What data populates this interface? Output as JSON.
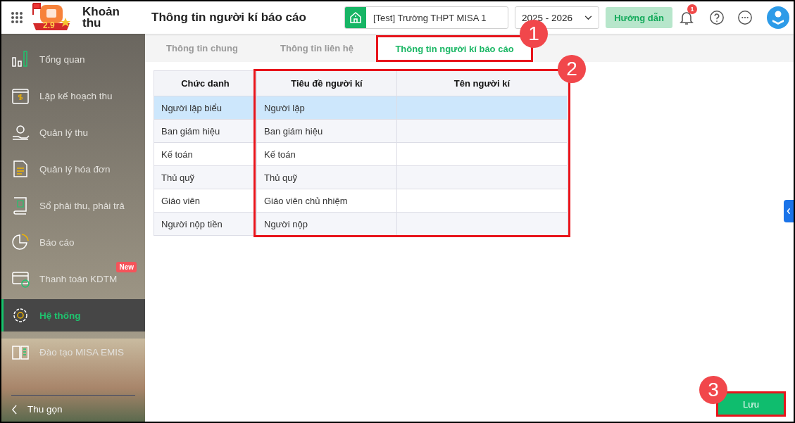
{
  "header": {
    "app_name": "Khoản thu",
    "logo_badge": "2.9",
    "page_title": "Thông tin người kí báo cáo",
    "school": "[Test] Trường THPT MISA 1",
    "year": "2025 - 2026",
    "guide_button": "Hướng dẫn",
    "notification_count": "1"
  },
  "sidebar": {
    "items": [
      {
        "label": "Tổng quan",
        "selected": false
      },
      {
        "label": "Lập kế hoạch thu",
        "selected": false
      },
      {
        "label": "Quản lý thu",
        "selected": false
      },
      {
        "label": "Quản lý hóa đơn",
        "selected": false
      },
      {
        "label": "Sổ phải thu, phải trả",
        "selected": false
      },
      {
        "label": "Báo cáo",
        "selected": false
      },
      {
        "label": "Thanh toán KDTM",
        "selected": false,
        "badge": "New"
      },
      {
        "label": "Hệ thống",
        "selected": true
      },
      {
        "label": "Đào tạo MISA EMIS",
        "selected": false
      }
    ],
    "collapse_label": "Thu gọn"
  },
  "tabs": [
    {
      "label": "Thông tin chung",
      "selected": false
    },
    {
      "label": "Thông tin liên hệ",
      "selected": false
    },
    {
      "label": "Thông tin người kí báo cáo",
      "selected": true,
      "annotation": "1"
    }
  ],
  "table": {
    "columns": [
      "Chức danh",
      "Tiêu đề người kí",
      "Tên người kí"
    ],
    "annotation": "2",
    "rows": [
      {
        "cells": [
          "Người lập biểu",
          "Người lập",
          ""
        ],
        "selected": true
      },
      {
        "cells": [
          "Ban giám hiệu",
          "Ban giám hiệu",
          ""
        ],
        "selected": false
      },
      {
        "cells": [
          "Kế toán",
          "Kế toán",
          ""
        ],
        "selected": false
      },
      {
        "cells": [
          "Thủ quỹ",
          "Thủ quỹ",
          ""
        ],
        "selected": false
      },
      {
        "cells": [
          "Giáo viên",
          "Giáo viên chủ nhiệm",
          ""
        ],
        "selected": false
      },
      {
        "cells": [
          "Người nộp tiền",
          "Người nộp",
          ""
        ],
        "selected": false
      }
    ]
  },
  "save_button": {
    "label": "Lưu",
    "annotation": "3"
  }
}
